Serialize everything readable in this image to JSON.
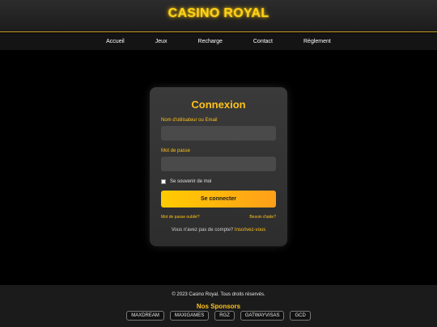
{
  "header": {
    "title": "CASINO ROYAL"
  },
  "nav": {
    "items": [
      "Accueil",
      "Jeux",
      "Recharge",
      "Contact",
      "Règlement"
    ]
  },
  "login": {
    "title": "Connexion",
    "username_label": "Nom d'utilisateur ou Email",
    "username_value": "",
    "password_label": "Mot de passe",
    "password_value": "",
    "remember_label": "Se souvenir de moi",
    "remember_checked": false,
    "submit_label": "Se connecter",
    "forgot_label": "Mot de passe oublié?",
    "help_label": "Besoin d'aide?",
    "no_account_text": "Vous n'avez pas de compte?",
    "signup_label": "Inscrivez-vous"
  },
  "footer": {
    "copyright": "© 2023 Casino Royal. Tous droits réservés.",
    "sponsors_title": "Nos Sponsors",
    "sponsors": [
      "MAXDREAM",
      "MAXIGAMES",
      "RGZ",
      "GATWAYVISAS",
      "GCD"
    ]
  },
  "colors": {
    "accent": "#ffc21a",
    "background": "#000000",
    "card": "#333333"
  }
}
